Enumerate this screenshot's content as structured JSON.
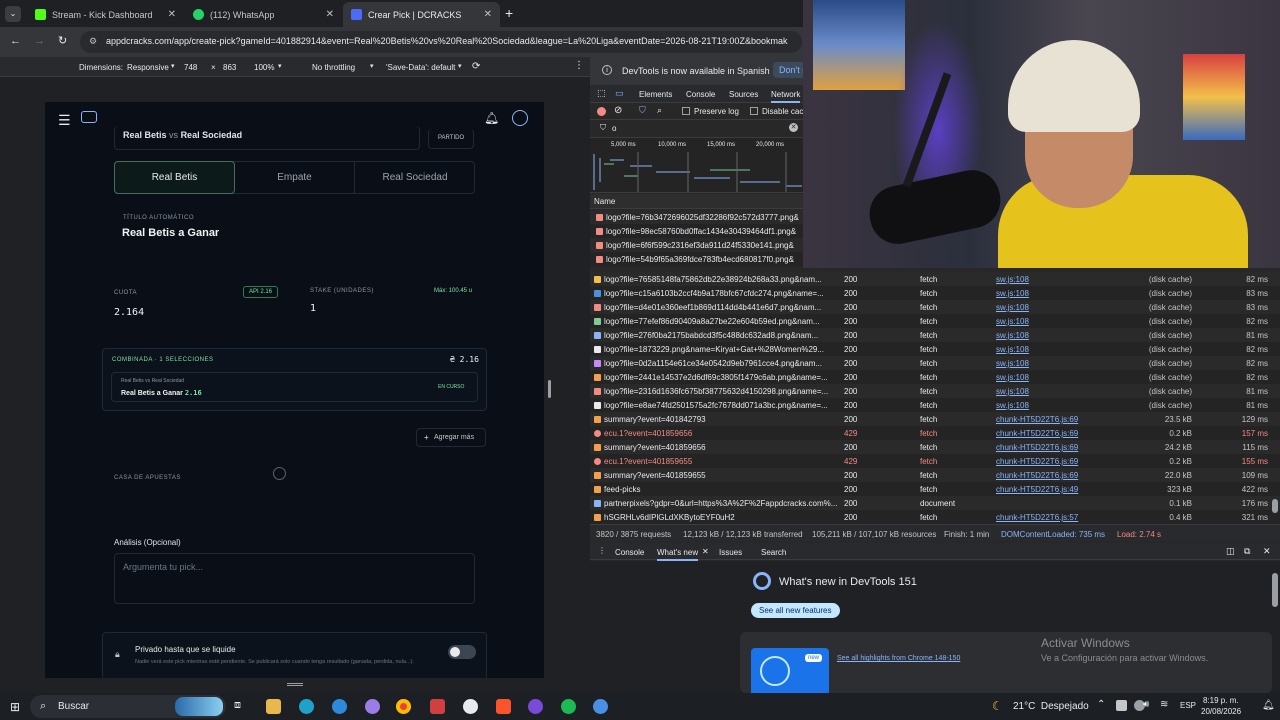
{
  "browser": {
    "tabs": [
      {
        "title": "Stream - Kick Dashboard",
        "color": "#53fc18"
      },
      {
        "title": "(112) WhatsApp",
        "color": "#25d366"
      },
      {
        "title": "Crear Pick | DCRACKS",
        "color": "#4a6cf7"
      }
    ],
    "url": "appdcracks.com/app/create-pick?gameId=401882914&event=Real%20Betis%20vs%20Real%20Sociedad&league=La%20Liga&eventDate=2026-08-21T19:00Z&bookmak"
  },
  "device_toolbar": {
    "dimensions_label": "Dimensions:",
    "dimensions_value": "Responsive",
    "width": "748",
    "height": "863",
    "zoom": "100%",
    "throttling": "No throttling",
    "save_data": "'Save-Data': default"
  },
  "app": {
    "event_title_vs": "vs",
    "event_title_home": "Real Betis",
    "event_title_away": "Real Sociedad",
    "event_tag": "PARTIDO",
    "outcomes": [
      "Real Betis",
      "Empate",
      "Real Sociedad"
    ],
    "auto_title_label": "TÍTULO AUTOMÁTICO",
    "auto_title": "Real Betis a Ganar",
    "odds_label": "CUOTA",
    "api_badge": "API 2.16",
    "odds_value": "2.164",
    "stake_label": "STAKE (UNIDADES)",
    "stake_max": "Máx: 100.45 u",
    "stake_value": "1",
    "combo_label": "COMBINADA · 1 SELECCIONES",
    "combo_total": "₴ 2.16",
    "combo_item_event": "Real Betis vs Real Sociedad",
    "combo_item_pick": "Real Betis a Ganar",
    "combo_item_odds": "2.16",
    "combo_item_status": "EN CURSO",
    "add_more": "Agregar más",
    "bookmaker_label": "CASA DE APUESTAS",
    "analysis_label": "Análisis (Opcional)",
    "analysis_placeholder": "Argumenta tu pick...",
    "private_label": "Privado hasta que se liquide",
    "private_desc": "Nadie verá este pick mientras esté pendiente. Se publicará solo cuando tenga resultado (ganada, perdida, nula...)."
  },
  "devtools": {
    "notice": "DevTools is now available in Spanish",
    "notice_btn": "Don't s",
    "tabs": [
      "Elements",
      "Console",
      "Sources",
      "Network"
    ],
    "preserve_log": "Preserve log",
    "disable_cache": "Disable cac",
    "filter_value": "o",
    "timeline_ticks": [
      "5,000 ms",
      "10,000 ms",
      "15,000 ms",
      "20,000 ms"
    ],
    "name_header": "Name",
    "top_rows": [
      "logo?file=76b3472696025df32286f92c572d3777.png&",
      "logo?file=98ec58760bd0ffac1434e30439464df1.png&",
      "logo?file=6f6f599c2316ef3da911d24f5330e141.png&",
      "logo?file=54b9f65a369fdce783fb4ecd680817f0.png&"
    ],
    "rows": [
      {
        "name": "logo?file=76585148fa75862db22e38924b268a33.png&nam...",
        "status": "200",
        "type": "fetch",
        "initiator": "sw.js:108",
        "size": "(disk cache)",
        "time": "82 ms",
        "err": false
      },
      {
        "name": "logo?file=c15a6103b2ccf4b9a178bfc67cfdc274.png&name=...",
        "status": "200",
        "type": "fetch",
        "initiator": "sw.js:108",
        "size": "(disk cache)",
        "time": "83 ms",
        "err": false
      },
      {
        "name": "logo?file=d4e01e360eef1b869d114dd4b441e6d7.png&nam...",
        "status": "200",
        "type": "fetch",
        "initiator": "sw.js:108",
        "size": "(disk cache)",
        "time": "83 ms",
        "err": false
      },
      {
        "name": "logo?file=77efef86d90409a8a27be22e604b59ed.png&nam...",
        "status": "200",
        "type": "fetch",
        "initiator": "sw.js:108",
        "size": "(disk cache)",
        "time": "82 ms",
        "err": false
      },
      {
        "name": "logo?file=276f0ba2175babdcd3f5c488dc632ad8.png&nam...",
        "status": "200",
        "type": "fetch",
        "initiator": "sw.js:108",
        "size": "(disk cache)",
        "time": "81 ms",
        "err": false
      },
      {
        "name": "logo?file=1873229.png&name=Kiryat+Gat+%28Women%29...",
        "status": "200",
        "type": "fetch",
        "initiator": "sw.js:108",
        "size": "(disk cache)",
        "time": "82 ms",
        "err": false
      },
      {
        "name": "logo?file=0d2a1154e61ce34e0542d9eb7961cce4.png&nam...",
        "status": "200",
        "type": "fetch",
        "initiator": "sw.js:108",
        "size": "(disk cache)",
        "time": "82 ms",
        "err": false
      },
      {
        "name": "logo?file=2441e14537e2d6df69c3805f1479c6ab.png&name=...",
        "status": "200",
        "type": "fetch",
        "initiator": "sw.js:108",
        "size": "(disk cache)",
        "time": "82 ms",
        "err": false
      },
      {
        "name": "logo?file=2316d1636fc675bf38775632d4150298.png&name=...",
        "status": "200",
        "type": "fetch",
        "initiator": "sw.js:108",
        "size": "(disk cache)",
        "time": "81 ms",
        "err": false
      },
      {
        "name": "logo?file=e8ae74fd2501575a2fc7678dd071a3bc.png&name=...",
        "status": "200",
        "type": "fetch",
        "initiator": "sw.js:108",
        "size": "(disk cache)",
        "time": "81 ms",
        "err": false
      },
      {
        "name": "summary?event=401842793",
        "status": "200",
        "type": "fetch",
        "initiator": "chunk-HT5D22T6.js:69",
        "size": "23.5 kB",
        "time": "129 ms",
        "err": false
      },
      {
        "name": "ecu.1?event=401859656",
        "status": "429",
        "type": "fetch",
        "initiator": "chunk-HT5D22T6.js:69",
        "size": "0.2 kB",
        "time": "157 ms",
        "err": true
      },
      {
        "name": "summary?event=401859656",
        "status": "200",
        "type": "fetch",
        "initiator": "chunk-HT5D22T6.js:69",
        "size": "24.2 kB",
        "time": "115 ms",
        "err": false
      },
      {
        "name": "ecu.1?event=401859655",
        "status": "429",
        "type": "fetch",
        "initiator": "chunk-HT5D22T6.js:69",
        "size": "0.2 kB",
        "time": "155 ms",
        "err": true
      },
      {
        "name": "summary?event=401859655",
        "status": "200",
        "type": "fetch",
        "initiator": "chunk-HT5D22T6.js:69",
        "size": "22.0 kB",
        "time": "109 ms",
        "err": false
      },
      {
        "name": "feed-picks",
        "status": "200",
        "type": "fetch",
        "initiator": "chunk-HT5D22T6.js:49",
        "size": "323 kB",
        "time": "422 ms",
        "err": false
      },
      {
        "name": "partnerpixels?gdpr=0&url=https%3A%2F%2Fappdcracks.com%...",
        "status": "200",
        "type": "document",
        "initiator": "",
        "size": "0.1 kB",
        "time": "176 ms",
        "err": false
      },
      {
        "name": "hSGRHLv6dIPlGLdXKBytoEYF0uH2",
        "status": "200",
        "type": "fetch",
        "initiator": "chunk-HT5D22T6.js:57",
        "size": "0.4 kB",
        "time": "321 ms",
        "err": false
      }
    ],
    "status_bar": {
      "requests": "3820 / 3875 requests",
      "transferred": "12,123 kB / 12,123 kB transferred",
      "resources": "105,211 kB / 107,107 kB resources",
      "finish": "Finish: 1 min",
      "dcl": "DOMContentLoaded: 735 ms",
      "load": "Load: 2.74 s"
    },
    "drawer_tabs": [
      "Console",
      "What's new",
      "Issues",
      "Search"
    ],
    "whats_new_title": "What's new in DevTools 151",
    "see_all": "See all new features",
    "new_badge": "new",
    "highlights_link": "See all highlights from Chrome 148-150",
    "activate_title": "Activar Windows",
    "activate_desc": "Ve a Configuración para activar Windows."
  },
  "taskbar": {
    "search": "Buscar",
    "weather": "21°C  Despejado",
    "lang": "ESP",
    "time": "8:19 p. m.",
    "date": "20/08/2026"
  }
}
